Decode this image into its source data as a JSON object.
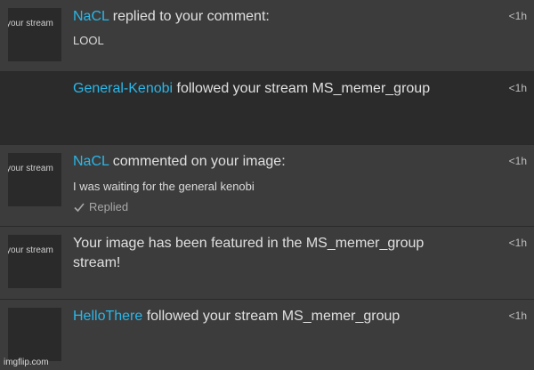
{
  "notifications": [
    {
      "thumb_label": "your stream",
      "user": "NaCL",
      "action": " replied to your comment:",
      "body": "LOOL",
      "time": "<1h"
    },
    {
      "user": "General-Kenobi",
      "action": " followed your stream MS_memer_group",
      "time": "<1h"
    },
    {
      "thumb_label": "your stream",
      "user": "NaCL",
      "action": " commented on your image:",
      "body": "I was waiting for the general kenobi",
      "replied_label": "Replied",
      "time": "<1h"
    },
    {
      "thumb_label": "your stream",
      "text_line1": "Your image has been featured in the MS_memer_group",
      "text_line2": "stream!",
      "time": "<1h"
    },
    {
      "user": "HelloThere",
      "action": " followed your stream MS_memer_group",
      "time": "<1h"
    }
  ],
  "watermark": "imgflip.com",
  "colors": {
    "username": "#2ab7e8",
    "background": "#3a3a3a",
    "dark_row": "#2b2b2b"
  }
}
